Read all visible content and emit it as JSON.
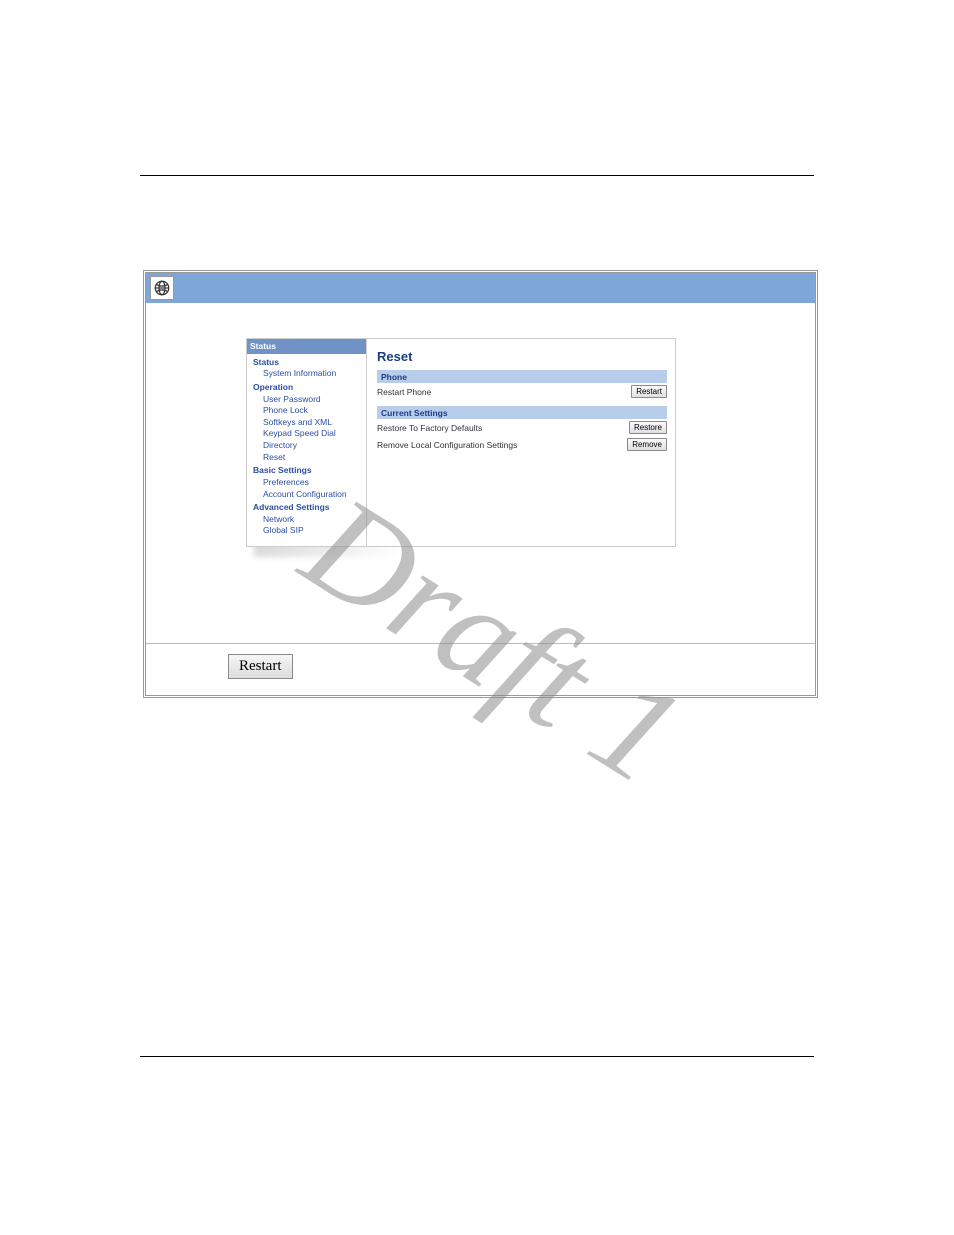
{
  "watermark": "Draft 1",
  "nav": {
    "title": "Status",
    "groups": [
      {
        "header": "Status",
        "items": [
          "System Information"
        ]
      },
      {
        "header": "Operation",
        "items": [
          "User Password",
          "Phone Lock",
          "Softkeys and XML",
          "Keypad Speed Dial",
          "Directory",
          "Reset"
        ]
      },
      {
        "header": "Basic Settings",
        "items": [
          "Preferences",
          "Account Configuration"
        ]
      },
      {
        "header": "Advanced Settings",
        "items": [
          "Network",
          "Global SIP"
        ]
      }
    ]
  },
  "content": {
    "heading": "Reset",
    "sections": [
      {
        "bar": "Phone",
        "rows": [
          {
            "label": "Restart Phone",
            "button": "Restart"
          }
        ]
      },
      {
        "bar": "Current Settings",
        "rows": [
          {
            "label": "Restore To Factory Defaults",
            "button": "Restore"
          },
          {
            "label": "Remove Local Configuration Settings",
            "button": "Remove"
          }
        ]
      }
    ]
  },
  "footer_button": "Restart"
}
